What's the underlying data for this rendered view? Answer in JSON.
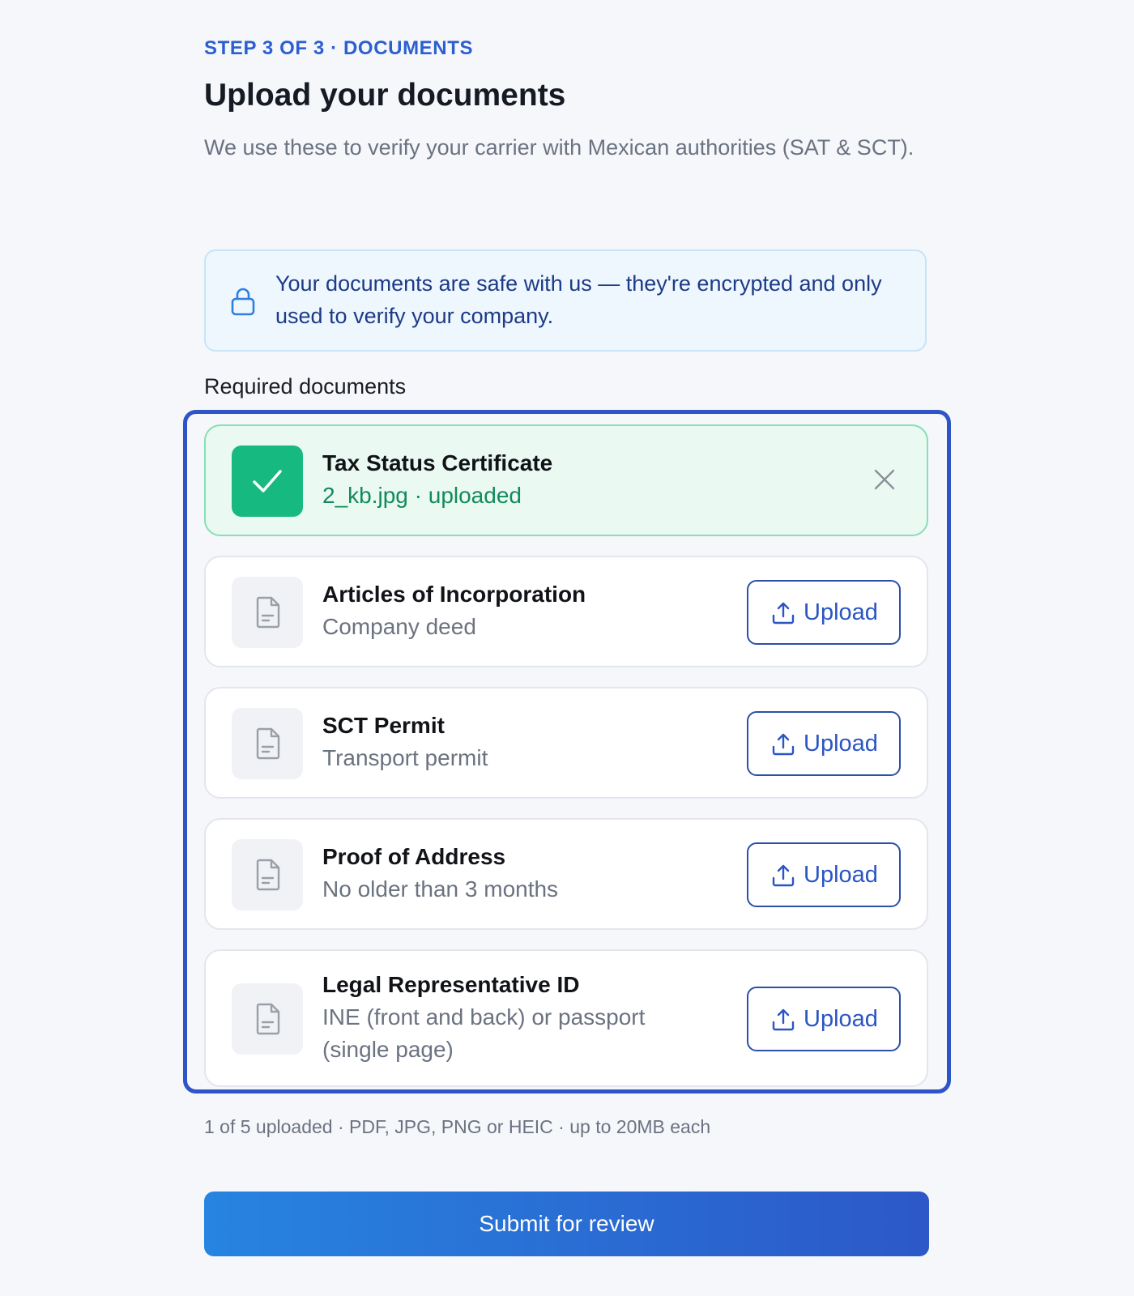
{
  "header": {
    "step": "STEP 3 OF 3 · DOCUMENTS",
    "title": "Upload your documents",
    "subtitle": "We use these to verify your carrier with Mexican authorities (SAT & SCT)."
  },
  "notice": {
    "icon": "lock-icon",
    "text": "Your documents are safe with us — they're encrypted and only used to verify your company."
  },
  "documents": {
    "label": "Required documents",
    "items": [
      {
        "name": "Tax Status Certificate",
        "detail": "2_kb.jpg · uploaded",
        "status": "uploaded",
        "icon": "check-icon"
      },
      {
        "name": "Articles of Incorporation",
        "detail": "Company deed",
        "status": "pending",
        "icon": "document-icon",
        "button": "Upload"
      },
      {
        "name": "SCT Permit",
        "detail": "Transport permit",
        "status": "pending",
        "icon": "document-icon",
        "button": "Upload"
      },
      {
        "name": "Proof of Address",
        "detail": "No older than 3 months",
        "status": "pending",
        "icon": "document-icon",
        "button": "Upload"
      },
      {
        "name": "Legal Representative ID",
        "detail": "INE (front and back) or passport (single page)",
        "status": "pending",
        "icon": "document-icon",
        "button": "Upload"
      }
    ]
  },
  "footer": {
    "note": "1 of 5 uploaded · PDF, JPG, PNG or HEIC · up to 20MB each",
    "submit_label": "Submit for review"
  },
  "colors": {
    "accent": "#2d5fcf",
    "success": "#16b97f",
    "focus_ring": "#2d55c8"
  }
}
